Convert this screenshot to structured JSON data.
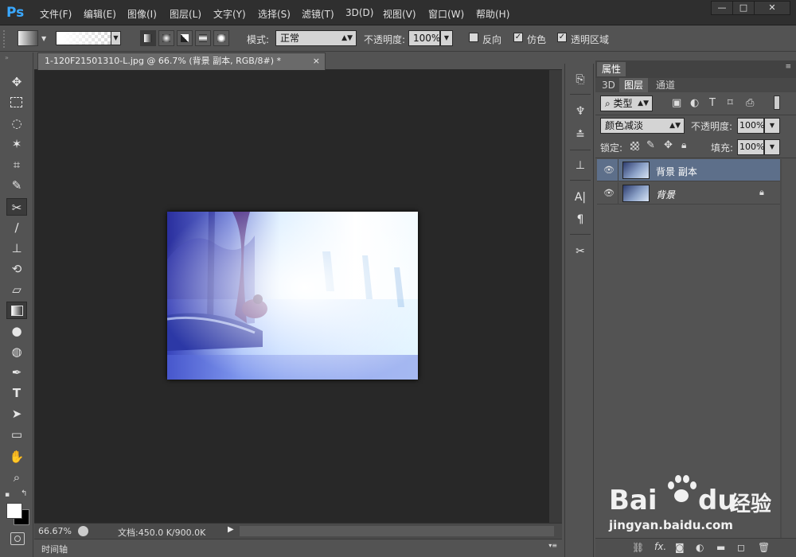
{
  "app": {
    "logo": "Ps"
  },
  "menu": [
    "文件(F)",
    "编辑(E)",
    "图像(I)",
    "图层(L)",
    "文字(Y)",
    "选择(S)",
    "滤镜(T)",
    "3D(D)",
    "视图(V)",
    "窗口(W)",
    "帮助(H)"
  ],
  "window_controls": {
    "minimize": "—",
    "maximize": "□",
    "close": "✕"
  },
  "options": {
    "mode_label": "模式:",
    "mode_value": "正常",
    "opacity_label": "不透明度:",
    "opacity_value": "100%",
    "reverse_label": "反向",
    "dither_label": "仿色",
    "transparency_label": "透明区域"
  },
  "document": {
    "tab_title": "1-120F21501310-L.jpg @ 66.7% (背景 副本, RGB/8#) *",
    "tab_close": "×",
    "zoom": "66.67%",
    "doc_size": "文档:450.0 K/900.0K"
  },
  "timeline": {
    "label": "时间轴"
  },
  "panels": {
    "properties_tab": "属性",
    "tabs": [
      "3D",
      "图层",
      "通道"
    ],
    "filter_kind": "类型",
    "blend_mode": "颜色减淡",
    "opacity_label": "不透明度:",
    "opacity_value": "100%",
    "lock_label": "锁定:",
    "fill_label": "填充:",
    "fill_value": "100%"
  },
  "layers": [
    {
      "name": "背景 副本",
      "selected": true,
      "locked": false
    },
    {
      "name": "背景",
      "selected": false,
      "locked": true
    }
  ],
  "watermark": {
    "brand": "Bai",
    "brand2": "du",
    "brand_cn": "经验",
    "url": "jingyan.baidu.com"
  },
  "colors": {
    "accent": "#3aa8ff",
    "selected_layer": "#5d6f8a",
    "canvas": "#282828"
  }
}
